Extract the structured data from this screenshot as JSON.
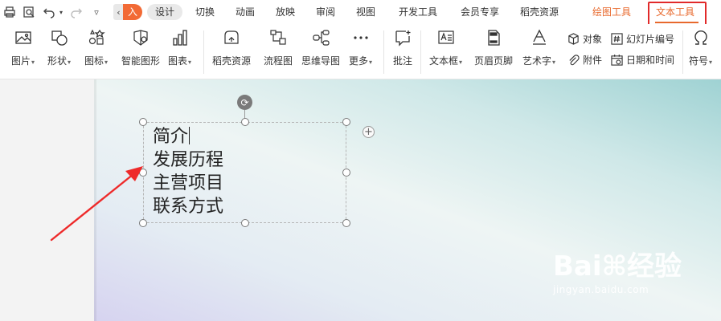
{
  "tabbar": {
    "scroll_glyph": "‹",
    "cut_tab": "入",
    "tabs": [
      "设计",
      "切换",
      "动画",
      "放映",
      "审阅",
      "视图",
      "开发工具",
      "会员专享",
      "稻壳资源",
      "绘图工具",
      "文本工具"
    ]
  },
  "ribbon": {
    "items": [
      "图片",
      "形状",
      "图标",
      "智能图形",
      "图表",
      "稻壳资源",
      "流程图",
      "思维导图",
      "更多",
      "批注",
      "文本框",
      "页眉页脚",
      "艺术字",
      "符号"
    ],
    "small": [
      "对象",
      "附件",
      "幻灯片编号",
      "日期和时间"
    ]
  },
  "textbox": {
    "lines": [
      "简介",
      "发展历程",
      "主营项目",
      "联系方式"
    ]
  },
  "watermark": {
    "brand": "Bai⌘经验",
    "url": "jingyan.baidu.com"
  },
  "colors": {
    "accent": "#e8692d",
    "highlight_box": "#e12a2a",
    "active_tab_bg": "#e9e9e9"
  },
  "icons": [
    "print-icon",
    "preview-icon",
    "undo-icon",
    "redo-icon",
    "more-icon",
    "rotate-icon",
    "add-icon"
  ]
}
